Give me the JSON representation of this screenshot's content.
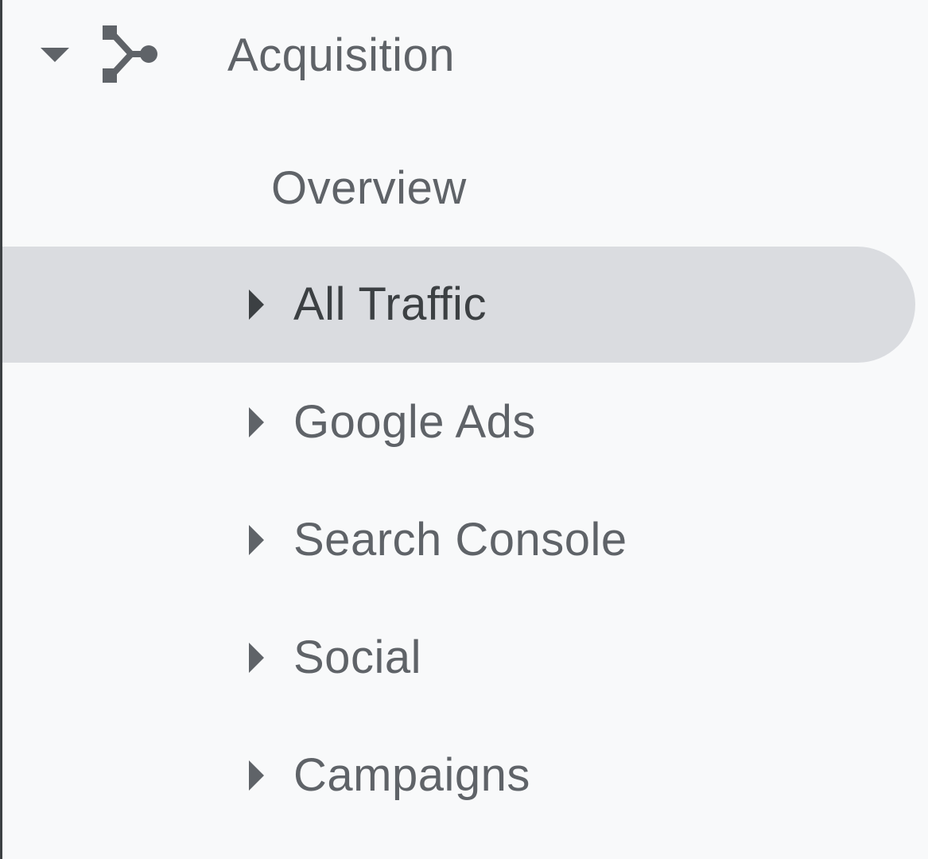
{
  "section": {
    "label": "Acquisition",
    "icon": "acquisition-icon",
    "expanded": true
  },
  "items": [
    {
      "label": "Overview",
      "has_children": false,
      "active": false
    },
    {
      "label": "All Traffic",
      "has_children": true,
      "active": true
    },
    {
      "label": "Google Ads",
      "has_children": true,
      "active": false
    },
    {
      "label": "Search Console",
      "has_children": true,
      "active": false
    },
    {
      "label": "Social",
      "has_children": true,
      "active": false
    },
    {
      "label": "Campaigns",
      "has_children": true,
      "active": false
    }
  ],
  "colors": {
    "background": "#f8f9fa",
    "active_background": "#dadce0",
    "text": "#5f6368",
    "active_text": "#3c4043"
  }
}
